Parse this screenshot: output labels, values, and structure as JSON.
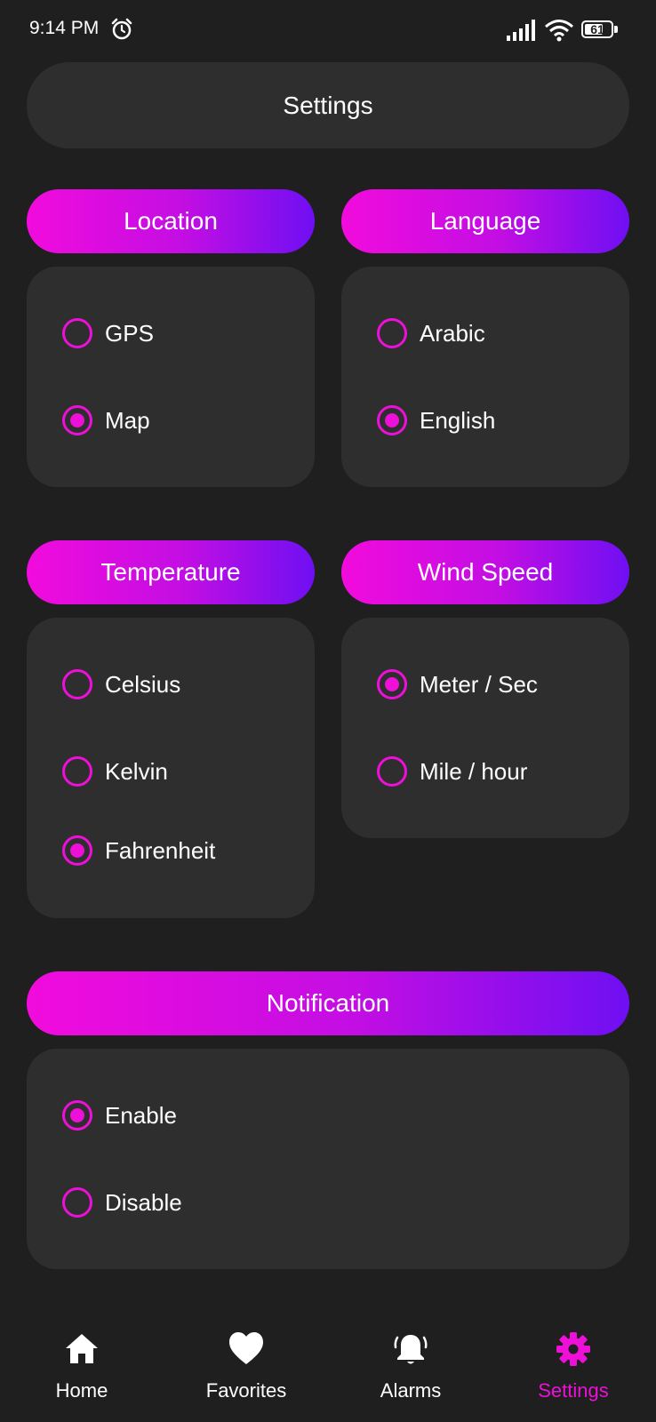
{
  "status_bar": {
    "time": "9:14 PM",
    "battery": "61"
  },
  "header": {
    "title": "Settings"
  },
  "sections": {
    "location": {
      "title": "Location",
      "options": [
        "GPS",
        "Map"
      ],
      "selected": 1
    },
    "language": {
      "title": "Language",
      "options": [
        "Arabic",
        "English"
      ],
      "selected": 1
    },
    "temperature": {
      "title": "Temperature",
      "options": [
        "Celsius",
        "Kelvin",
        "Fahrenheit"
      ],
      "selected": 2
    },
    "wind_speed": {
      "title": "Wind Speed",
      "options": [
        "Meter / Sec",
        "Mile / hour"
      ],
      "selected": 0
    },
    "notification": {
      "title": "Notification",
      "options": [
        "Enable",
        "Disable"
      ],
      "selected": 0
    }
  },
  "bottom_nav": {
    "items": [
      {
        "label": "Home",
        "icon": "home-icon"
      },
      {
        "label": "Favorites",
        "icon": "heart-icon"
      },
      {
        "label": "Alarms",
        "icon": "bell-icon"
      },
      {
        "label": "Settings",
        "icon": "gear-icon"
      }
    ],
    "active": 3
  },
  "colors": {
    "accent": "#ee0fd9",
    "gradient_start": "#f20bdd",
    "gradient_end": "#6f0ff3",
    "background": "#1f1f1f",
    "card": "#2e2e2e"
  }
}
